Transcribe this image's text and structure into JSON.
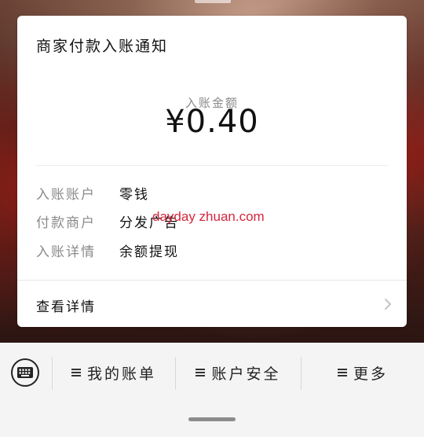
{
  "notification": {
    "title": "商家付款入账通知",
    "amount_label": "入账金额",
    "amount": "¥0.40",
    "details": [
      {
        "key": "入账账户",
        "value": "零钱"
      },
      {
        "key": "付款商户",
        "value": "分发广告"
      },
      {
        "key": "入账详情",
        "value": "余额提现"
      }
    ],
    "view_details_label": "查看详情"
  },
  "watermark": "dayday zhuan.com",
  "menu": {
    "items": [
      {
        "label": "我的账单"
      },
      {
        "label": "账户安全"
      },
      {
        "label": "更多"
      }
    ]
  },
  "icons": {
    "keyboard": "keyboard-icon",
    "chevron": "chevron-right-icon",
    "menu": "menu-lines-icon"
  },
  "colors": {
    "watermark": "#d7263d",
    "muted_text": "#8a8a8a",
    "card_bg": "#ffffff",
    "bottom_bar_bg": "#f4f4f4"
  }
}
